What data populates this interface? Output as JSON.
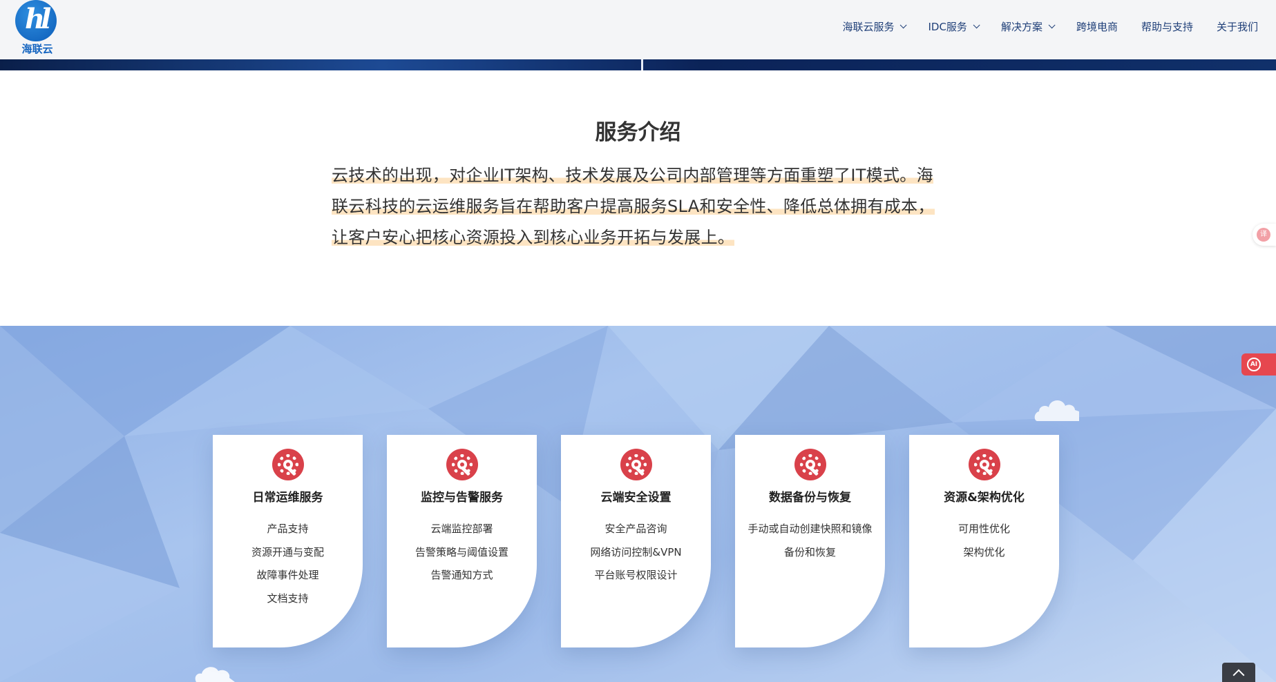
{
  "header": {
    "logo_text": "海联云",
    "nav": [
      {
        "label": "海联云服务",
        "dropdown": true
      },
      {
        "label": "IDC服务",
        "dropdown": true
      },
      {
        "label": "解决方案",
        "dropdown": true
      },
      {
        "label": "跨境电商",
        "dropdown": false
      },
      {
        "label": "帮助与支持",
        "dropdown": false
      },
      {
        "label": "关于我们",
        "dropdown": false
      }
    ]
  },
  "intro": {
    "title": "服务介绍",
    "lines": [
      "云技术的出现，对企业IT架构、技术发展及公司内部管理等方面重塑了IT模式。海",
      "联云科技的云运维服务旨在帮助客户提高服务SLA和安全性、降低总体拥有成本，",
      "让客户安心把核心资源投入到核心业务开拓与发展上。"
    ]
  },
  "services": [
    {
      "title": "日常运维服务",
      "icon": "gear-wrench-icon",
      "items": [
        "产品支持",
        "资源开通与变配",
        "故障事件处理",
        "文档支持"
      ]
    },
    {
      "title": "监控与告警服务",
      "icon": "gear-wrench-icon",
      "items": [
        "云端监控部署",
        "告警策略与阈值设置",
        "告警通知方式"
      ]
    },
    {
      "title": "云端安全设置",
      "icon": "gear-wrench-icon",
      "items": [
        "安全产品咨询",
        "网络访问控制&VPN",
        "平台账号权限设计"
      ]
    },
    {
      "title": "数据备份与恢复",
      "icon": "gear-wrench-icon",
      "items": [
        "手动或自动创建快照和镜像",
        "备份和恢复"
      ]
    },
    {
      "title": "资源&架构优化",
      "icon": "gear-wrench-icon",
      "items": [
        "可用性优化",
        "架构优化"
      ]
    }
  ],
  "colors": {
    "accent": "#d9414a",
    "nav_text": "#1f3f78",
    "highlight": "#fde4c2",
    "services_bg": "#9dbbea"
  },
  "icons": {
    "translate": "translate-icon",
    "ai": "ai-icon",
    "back_to_top": "chevron-up-icon",
    "cloud": "cloud-icon"
  }
}
